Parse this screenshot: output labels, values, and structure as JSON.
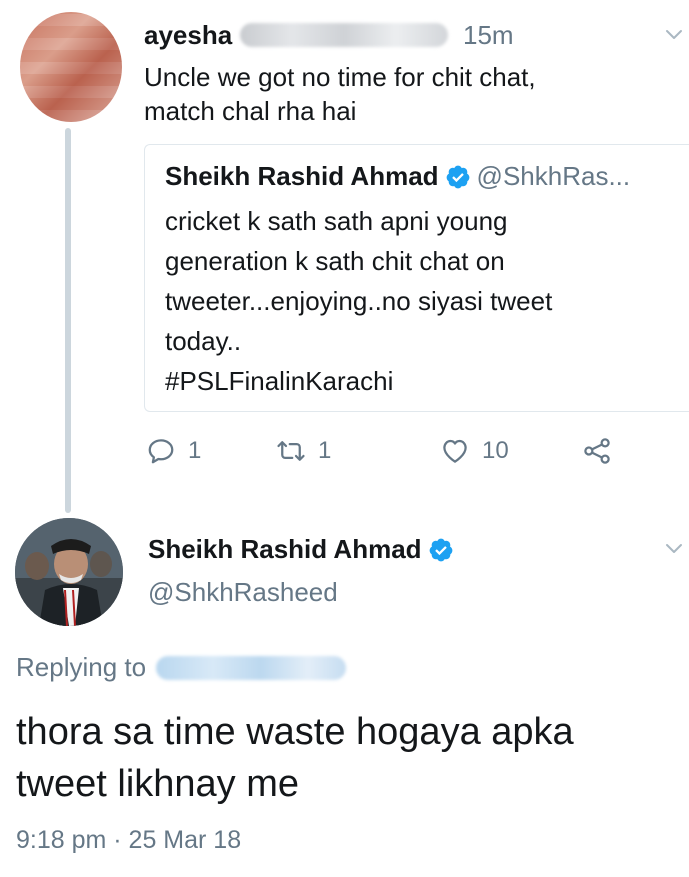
{
  "reply_tweet": {
    "author_name": "ayesha",
    "time": "15m",
    "text_lines": [
      "Uncle we got no time for chit chat,",
      "match chal rha hai"
    ],
    "quoted": {
      "author_name": "Sheikh Rashid Ahmad",
      "handle": "@ShkhRas...",
      "verified": true,
      "text_lines": [
        "cricket k sath sath apni  young",
        "generation k sath chit chat on",
        "tweeter...enjoying..no siyasi tweet",
        "today..",
        "#PSLFinalinKarachi"
      ]
    },
    "actions": {
      "reply_count": "1",
      "retweet_count": "1",
      "like_count": "10"
    }
  },
  "main_tweet": {
    "author_name": "Sheikh Rashid Ahmad",
    "handle": "@ShkhRasheed",
    "verified": true,
    "replying_to_label": "Replying to",
    "text_lines": [
      "thora sa time waste hogaya apka",
      "tweet likhnay me"
    ],
    "timestamp": "9:18 pm · 25 Mar 18"
  },
  "colors": {
    "text_primary": "#14171a",
    "text_secondary": "#657786",
    "verified_blue": "#1da1f2",
    "border": "#e1e8ed",
    "thread_line": "#ccd6dd"
  },
  "icons": [
    "chevron-down-icon",
    "verified-badge-icon",
    "reply-icon",
    "retweet-icon",
    "like-icon",
    "share-icon"
  ]
}
